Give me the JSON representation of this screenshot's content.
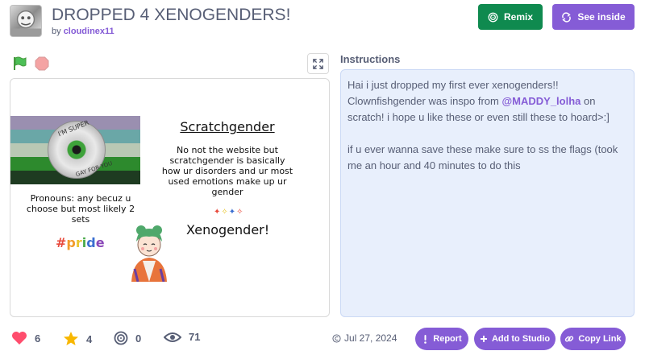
{
  "project": {
    "title": "DROPPED 4 XENOGENDERS!",
    "by_prefix": "by",
    "author": "cloudinex11"
  },
  "actions": {
    "remix_label": "Remix",
    "see_inside_label": "See inside"
  },
  "stage": {
    "cd_text_top": "I'M SUPER",
    "cd_text_bottom": "GAY FOR YOU",
    "heading": "Scratchgender",
    "description": "No not the website but scratchgender is basically how ur disorders and ur most used emotions make up ur gender",
    "pronouns": "Pronouns: any becuz u choose but most likely 2 sets",
    "pride_tag": "#pride",
    "xenogender_label": "Xenogender!",
    "flag_colors": [
      "#9a8fb0",
      "#6aa7a7",
      "#b9c8b4",
      "#2d8a2d",
      "#1e3b21"
    ],
    "pride_colors": [
      "#e84a3c",
      "#f29b2a",
      "#e8c631",
      "#4bab4b",
      "#3b6fd1",
      "#8a47b8"
    ]
  },
  "instructions": {
    "label": "Instructions",
    "line1_before": "Hai i just dropped my first ever xenogenders!! Clownfishgender was inspo from ",
    "mention": "@MADDY_lolha",
    "line1_after": " on scratch! i hope u like these or even still these to hoard>:]",
    "line2": "if u ever wanna save these make sure to ss the flags (took me an hour and 40 minutes to do this"
  },
  "stats": {
    "loves": "6",
    "favorites": "4",
    "remixes": "0",
    "views": "71"
  },
  "footer": {
    "date": "Jul 27, 2024",
    "report_label": "Report",
    "add_to_studio_label": "Add to Studio",
    "copy_link_label": "Copy Link"
  },
  "colors": {
    "accent": "#855cd6",
    "remix_green": "#0f8a4f",
    "heart": "#ff4d6d",
    "star": "#f8b700",
    "text": "#575e75",
    "instructions_bg": "#e8effc"
  }
}
